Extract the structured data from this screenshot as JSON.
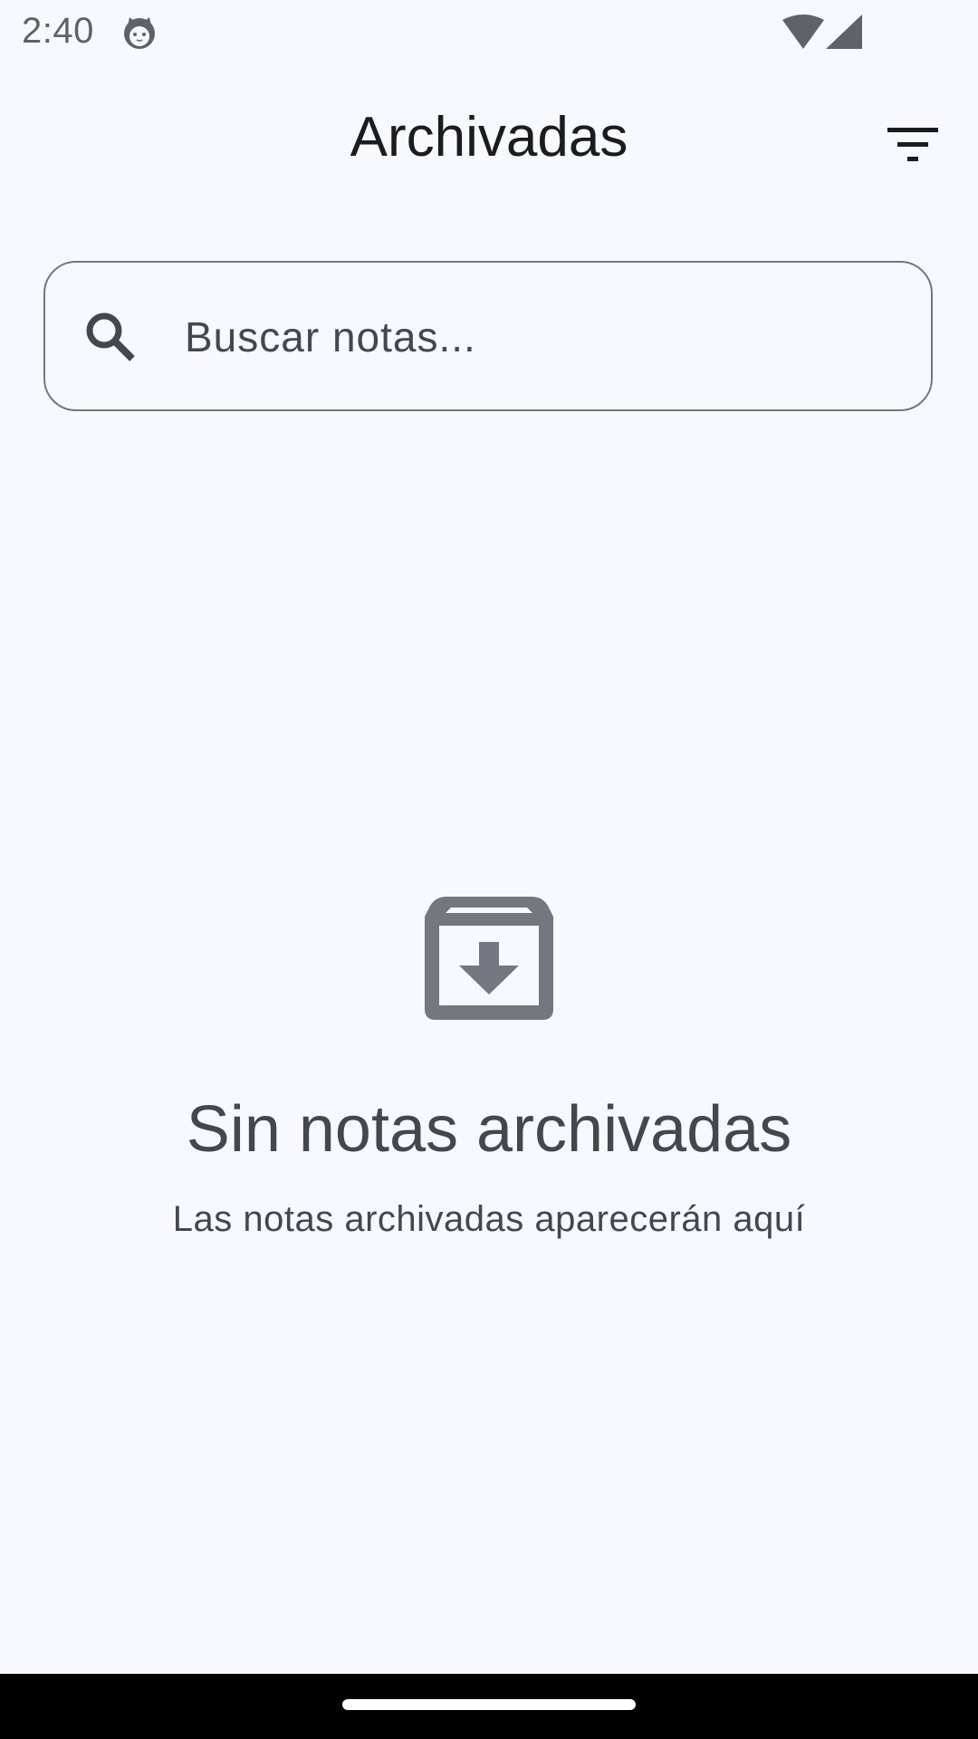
{
  "status_bar": {
    "time": "2:40",
    "app_icon": "cat-face-icon",
    "wifi_icon": "wifi-icon",
    "signal_icon": "cell-signal-icon"
  },
  "app_bar": {
    "title": "Archivadas",
    "filter_icon": "filter-icon"
  },
  "search": {
    "placeholder": "Buscar notas...",
    "value": "",
    "icon": "search-icon"
  },
  "empty_state": {
    "icon": "archive-icon",
    "title": "Sin notas archivadas",
    "subtitle": "Las notas archivadas aparecerán aquí"
  },
  "colors": {
    "background": "#f8f9fe",
    "title_text": "#1b1c20",
    "secondary_text": "#44474f",
    "icon_gray": "#74777f",
    "nav_bar": "#000000"
  }
}
